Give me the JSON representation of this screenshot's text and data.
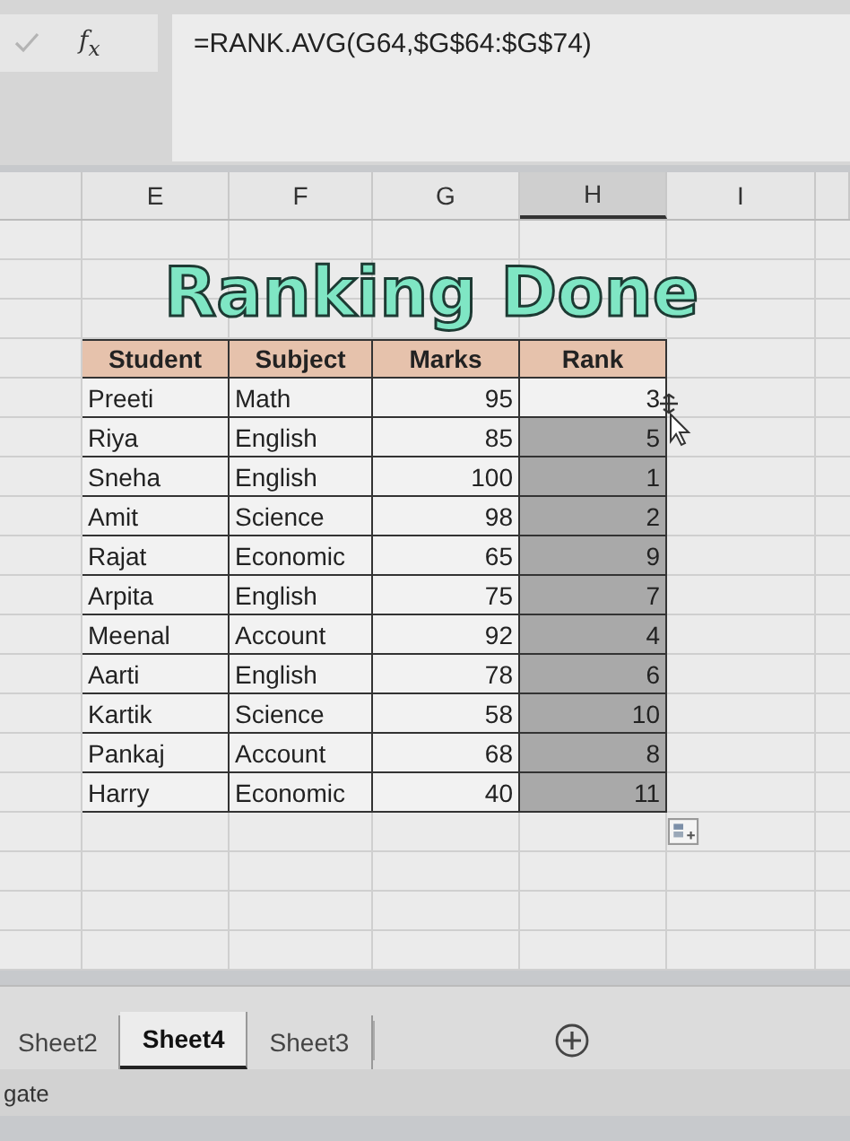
{
  "formula_bar": {
    "function_label": "f$_{x}$",
    "formula": "=RANK.AVG(G64,$G$64:$G$74)"
  },
  "columns": [
    {
      "label": "E",
      "selected": false
    },
    {
      "label": "F",
      "selected": false
    },
    {
      "label": "G",
      "selected": false
    },
    {
      "label": "H",
      "selected": true
    },
    {
      "label": "I",
      "selected": false
    }
  ],
  "title": "Ranking Done",
  "table": {
    "columns": [
      "Student",
      "Subject",
      "Marks",
      "Rank"
    ],
    "rows": [
      {
        "student": "Preeti",
        "subject": "Math",
        "marks": "95",
        "rank": "3",
        "selected": false
      },
      {
        "student": "Riya",
        "subject": "English",
        "marks": "85",
        "rank": "5",
        "selected": true
      },
      {
        "student": "Sneha",
        "subject": "English",
        "marks": "100",
        "rank": "1",
        "selected": true
      },
      {
        "student": "Amit",
        "subject": "Science",
        "marks": "98",
        "rank": "2",
        "selected": true
      },
      {
        "student": "Rajat",
        "subject": "Economic",
        "marks": "65",
        "rank": "9",
        "selected": true
      },
      {
        "student": "Arpita",
        "subject": "English",
        "marks": "75",
        "rank": "7",
        "selected": true
      },
      {
        "student": "Meenal",
        "subject": "Account",
        "marks": "92",
        "rank": "4",
        "selected": true
      },
      {
        "student": "Aarti",
        "subject": "English",
        "marks": "78",
        "rank": "6",
        "selected": true
      },
      {
        "student": "Kartik",
        "subject": "Science",
        "marks": "58",
        "rank": "10",
        "selected": true
      },
      {
        "student": "Pankaj",
        "subject": "Account",
        "marks": "68",
        "rank": "8",
        "selected": true
      },
      {
        "student": "Harry",
        "subject": "Economic",
        "marks": "40",
        "rank": "11",
        "selected": true
      }
    ]
  },
  "sheet_tabs": [
    {
      "label": "Sheet2",
      "selected": false
    },
    {
      "label": "Sheet4",
      "selected": true
    },
    {
      "label": "Sheet3",
      "selected": false
    }
  ],
  "status_bar": {
    "text": "gate"
  }
}
